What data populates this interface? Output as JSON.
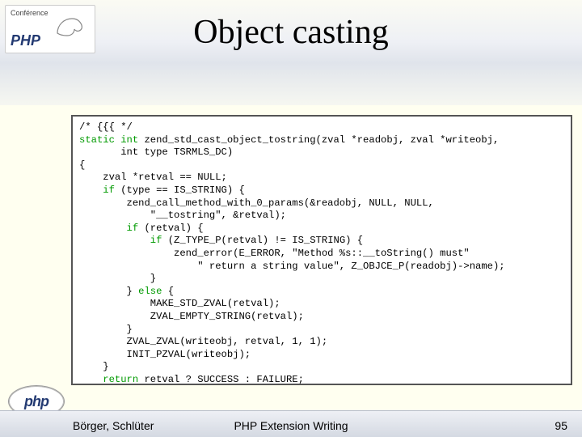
{
  "conf": {
    "label": "Conférence",
    "brand": "PHP"
  },
  "title": "Object casting",
  "code": {
    "l01a": "/* {{{ */",
    "l02a": "static int",
    "l02b": " zend_std_cast_object_tostring(zval *readobj, zval *writeobj, ",
    "l03": "       int type TSRMLS_DC)",
    "l04": "{",
    "l05": "    zval *retval == NULL;",
    "l06a": "    if",
    "l06b": " (type == IS_STRING) {",
    "l07": "        zend_call_method_with_0_params(&readobj, NULL, NULL, ",
    "l08": "            \"__tostring\", &retval);",
    "l09a": "        if",
    "l09b": " (retval) {",
    "l10a": "            if",
    "l10b": " (Z_TYPE_P(retval) != IS_STRING) {",
    "l11": "                zend_error(E_ERROR, \"Method %s::__toString() must\"",
    "l12": "                    \" return a string value\", Z_OBJCE_P(readobj)->name);",
    "l13": "            }",
    "l14a": "        } ",
    "l14b": "else",
    "l14c": " {",
    "l15": "            MAKE_STD_ZVAL(retval);",
    "l16": "            ZVAL_EMPTY_STRING(retval);",
    "l17": "        }",
    "l18": "        ZVAL_ZVAL(writeobj, retval, 1, 1);",
    "l19": "        INIT_PZVAL(writeobj);",
    "l20": "    }",
    "l21a": "    return",
    "l21b": " retval ? SUCCESS : FAILURE;",
    "l22": "} /* }}} */"
  },
  "footer": {
    "authors": "Börger, Schlüter",
    "center": "PHP Extension Writing",
    "page": "95"
  },
  "logo": {
    "text": "php"
  }
}
